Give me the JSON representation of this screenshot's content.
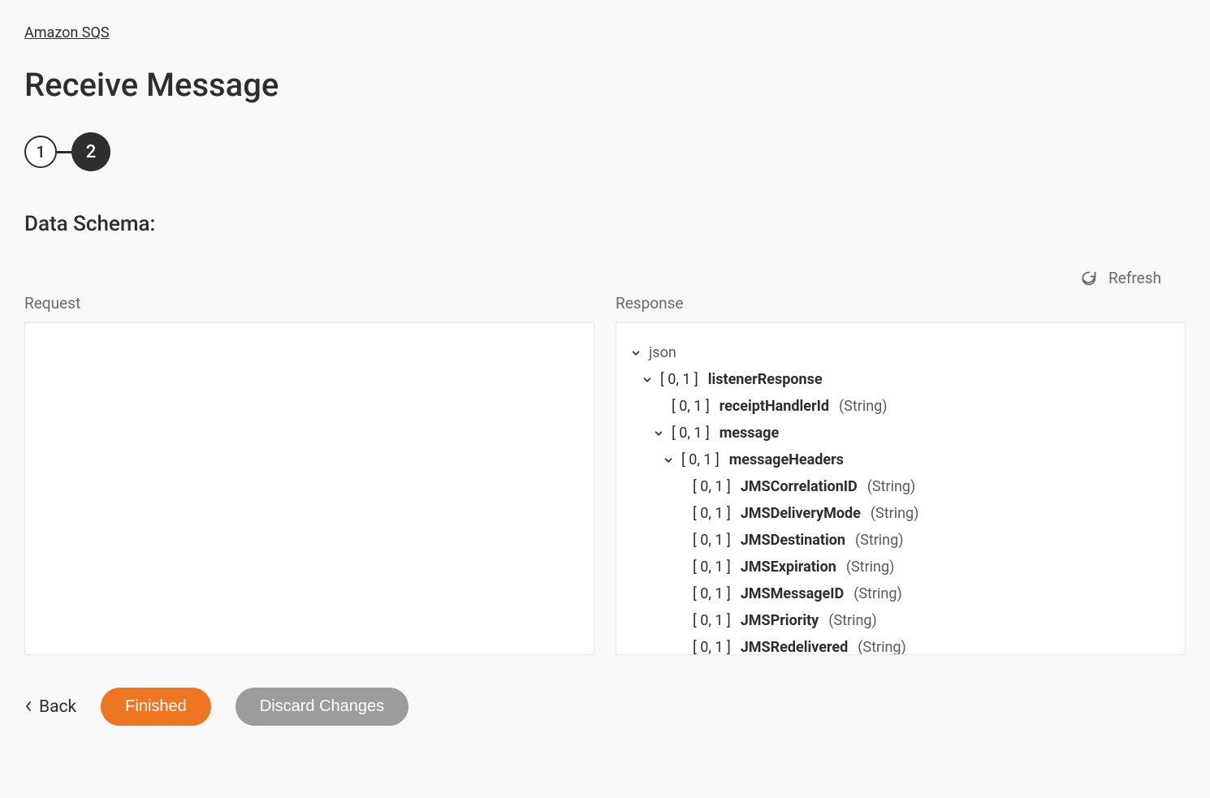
{
  "breadcrumb": "Amazon SQS",
  "page_title": "Receive Message",
  "stepper": {
    "steps": [
      "1",
      "2"
    ],
    "active_index": 1
  },
  "section_title": "Data Schema:",
  "refresh_label": "Refresh",
  "panels": {
    "request_label": "Request",
    "response_label": "Response"
  },
  "response_tree": {
    "root": "json",
    "nodes": [
      {
        "indent": 1,
        "toggle": true,
        "cardinality": "[ 0, 1 ]",
        "name": "listenerResponse",
        "type": ""
      },
      {
        "indent": 2,
        "toggle": false,
        "cardinality": "[ 0, 1 ]",
        "name": "receiptHandlerId",
        "type": "(String)"
      },
      {
        "indent": 2,
        "toggle": true,
        "cardinality": "[ 0, 1 ]",
        "name": "message",
        "type": ""
      },
      {
        "indent": 3,
        "toggle": true,
        "cardinality": "[ 0, 1 ]",
        "name": "messageHeaders",
        "type": ""
      },
      {
        "indent": 4,
        "toggle": false,
        "cardinality": "[ 0, 1 ]",
        "name": "JMSCorrelationID",
        "type": "(String)"
      },
      {
        "indent": 4,
        "toggle": false,
        "cardinality": "[ 0, 1 ]",
        "name": "JMSDeliveryMode",
        "type": "(String)"
      },
      {
        "indent": 4,
        "toggle": false,
        "cardinality": "[ 0, 1 ]",
        "name": "JMSDestination",
        "type": "(String)"
      },
      {
        "indent": 4,
        "toggle": false,
        "cardinality": "[ 0, 1 ]",
        "name": "JMSExpiration",
        "type": "(String)"
      },
      {
        "indent": 4,
        "toggle": false,
        "cardinality": "[ 0, 1 ]",
        "name": "JMSMessageID",
        "type": "(String)"
      },
      {
        "indent": 4,
        "toggle": false,
        "cardinality": "[ 0, 1 ]",
        "name": "JMSPriority",
        "type": "(String)"
      },
      {
        "indent": 4,
        "toggle": false,
        "cardinality": "[ 0, 1 ]",
        "name": "JMSRedelivered",
        "type": "(String)"
      }
    ]
  },
  "footer": {
    "back_label": "Back",
    "finished_label": "Finished",
    "discard_label": "Discard Changes"
  }
}
